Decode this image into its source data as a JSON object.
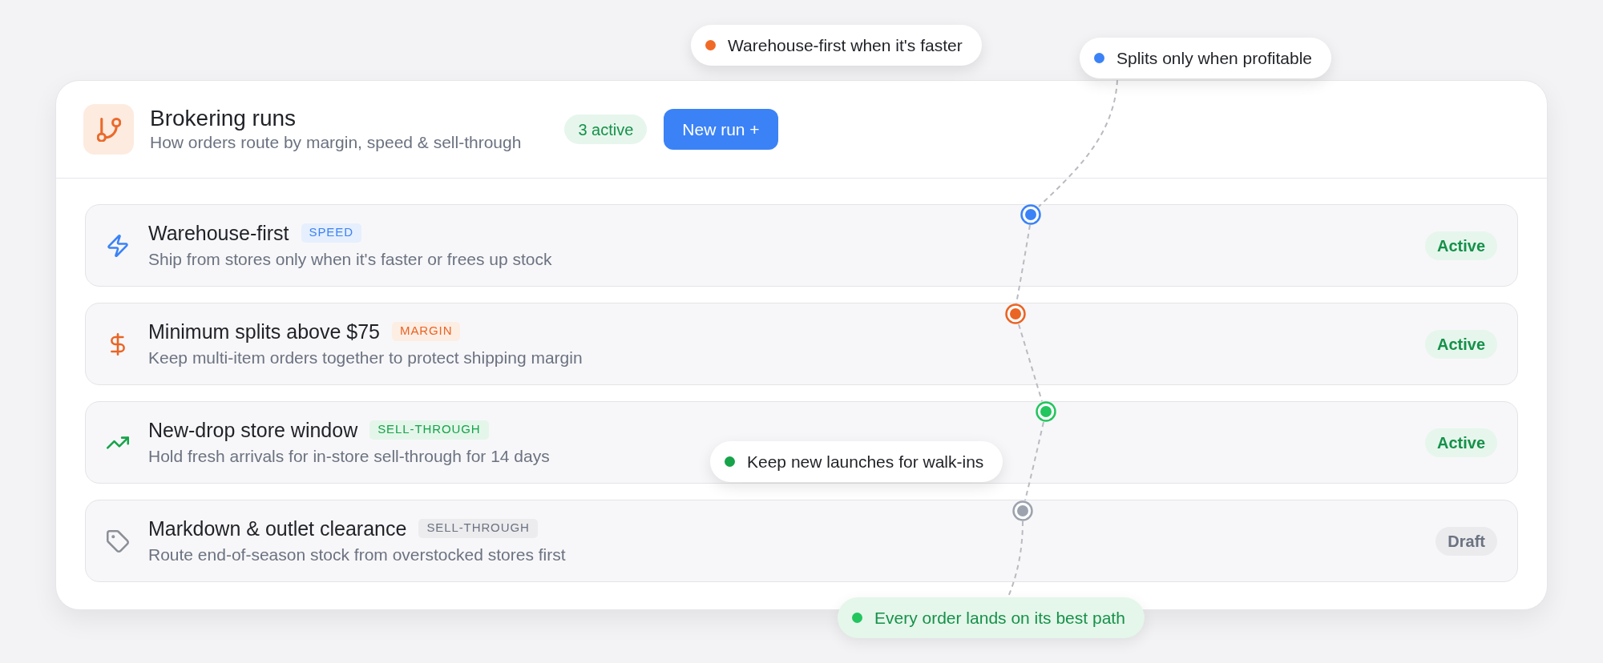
{
  "header": {
    "title": "Brokering runs",
    "subtitle": "How orders route by margin, speed & sell-through",
    "count_badge": "3 active",
    "new_button": "New run +"
  },
  "rows": [
    {
      "title": "Warehouse-first",
      "tag": {
        "label": "SPEED",
        "kind": "speed"
      },
      "description": "Ship from stores only when it's faster or frees up stock",
      "status": {
        "label": "Active",
        "kind": "active"
      },
      "color": "#3b82f6"
    },
    {
      "title": "Minimum splits above $75",
      "tag": {
        "label": "MARGIN",
        "kind": "margin"
      },
      "description": "Keep multi-item orders together to protect shipping margin",
      "status": {
        "label": "Active",
        "kind": "active"
      },
      "color": "#ea6424"
    },
    {
      "title": "New-drop store window",
      "tag": {
        "label": "SELL-THROUGH",
        "kind": "sell-through"
      },
      "description": "Hold fresh arrivals for in-store sell-through for 14 days",
      "status": {
        "label": "Active",
        "kind": "active"
      },
      "color": "#22c55e"
    },
    {
      "title": "Markdown & outlet clearance",
      "tag": {
        "label": "SELL-THROUGH",
        "kind": "muted"
      },
      "description": "Route end-of-season stock from overstocked stores first",
      "status": {
        "label": "Draft",
        "kind": "draft"
      },
      "color": "#9ca3af"
    }
  ],
  "callouts": [
    {
      "kind": "note",
      "text": "Warehouse-first when it's faster",
      "color": "#f06a27"
    },
    {
      "kind": "note",
      "text": "Splits only when profitable",
      "color": "#3b82f6"
    },
    {
      "kind": "note",
      "text": "Keep new launches for walk-ins",
      "color": "#16a34a"
    },
    {
      "kind": "summary",
      "text": "Every order lands on its best path",
      "color": "#22c55e"
    }
  ]
}
